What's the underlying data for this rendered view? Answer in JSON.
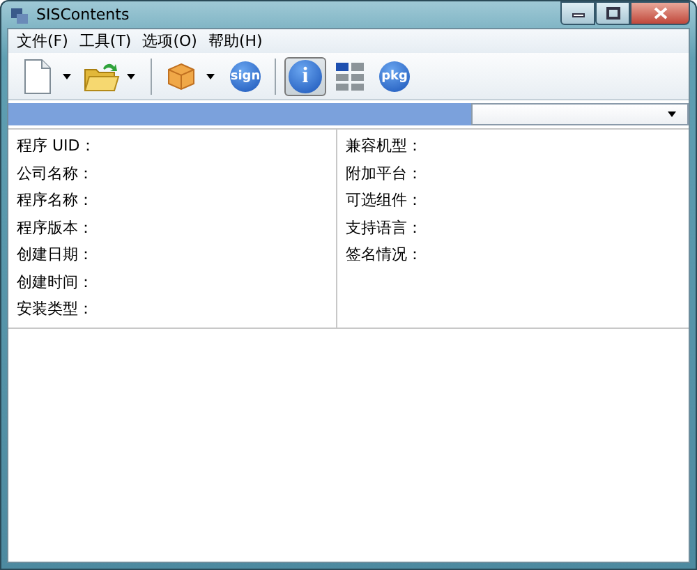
{
  "window": {
    "title": "SISContents"
  },
  "menu": [
    {
      "label": "文件(F)"
    },
    {
      "label": "工具(T)"
    },
    {
      "label": "选项(O)"
    },
    {
      "label": "帮助(H)"
    }
  ],
  "toolbar": [
    {
      "kind": "new-file",
      "dropdown": true,
      "selected": false
    },
    {
      "kind": "open-folder",
      "dropdown": true,
      "selected": false
    },
    {
      "kind": "separator"
    },
    {
      "kind": "box",
      "dropdown": true,
      "selected": false
    },
    {
      "kind": "badge",
      "text": "sign",
      "selected": false
    },
    {
      "kind": "separator"
    },
    {
      "kind": "badge",
      "text": "i",
      "selected": true
    },
    {
      "kind": "tiles",
      "selected": false
    },
    {
      "kind": "badge",
      "text": "pkg",
      "selected": false
    }
  ],
  "info": {
    "left": [
      "程序 UID：",
      "公司名称：",
      "程序名称：",
      "程序版本：",
      "创建日期：",
      "创建时间：",
      "安装类型："
    ],
    "right": [
      "兼容机型：",
      "附加平台：",
      "可选组件：",
      "支持语言：",
      "签名情况："
    ]
  }
}
